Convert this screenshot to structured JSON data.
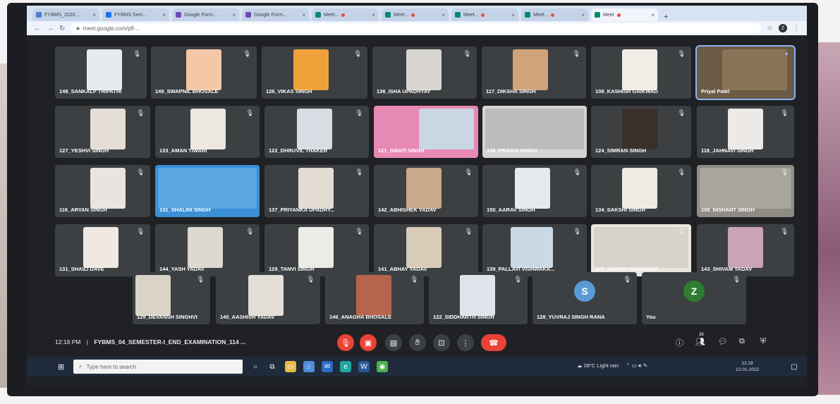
{
  "browser": {
    "tabs": [
      {
        "label": "FYBMS_2020..."
      },
      {
        "label": "FYBMS Sem..."
      },
      {
        "label": "Google Form..."
      },
      {
        "label": "Google Form..."
      },
      {
        "label": "Meet..."
      },
      {
        "label": "Meet..."
      },
      {
        "label": "Meet..."
      },
      {
        "label": "Meet..."
      },
      {
        "label": "Meet..."
      }
    ],
    "active_tab": {
      "label": "Meet"
    },
    "url": "meet.google.com/pfl-...",
    "profile_initial": "Z"
  },
  "participants": {
    "row1": [
      "148_SANKALP TRIPATHI",
      "149_SWAPNIL BHOSALE",
      "126_VIKAS SINGH",
      "136_ISHA UPADHYAY",
      "117_DIKSHA SINGH",
      "108_KASHISH GAIKWAD",
      "Priyal Patel"
    ],
    "row2": [
      "127_YESHVI SINGH",
      "133_AMAN TIWARI",
      "122_DHRUVIL THAKER",
      "121_SWATI SINGH",
      "130_PRACHI SINGH",
      "124_SIMRAN SINGH",
      "118_JAHNAVI SINGH"
    ],
    "row3": [
      "116_ARYAN SINGH",
      "131_SHALINI SINGH",
      "137_PRIYANKA UPADHY...",
      "142_ABHISHEK YADAV",
      "150_AARAV SINGH",
      "134_SAKSHI SINGH",
      "109_NISHANT SINGH"
    ],
    "row4": [
      "131_SHAILI DAVE",
      "144_YASH YADAV",
      "129_TANVI SINGH",
      "141_ABHAY YADAV",
      "139_PALLAVI VISHWAKA...",
      "147_SAKSHI VANASKAR",
      "143_SHIVAM YADAV"
    ],
    "row5": [
      "129_DEVANSH SINGHVI",
      "140_AASHISH YADAV",
      "146_ANAGHA BHOSALE",
      "122_SIDDHARTH SINGH",
      "128_YUVRAJ SINGH RANA",
      "You"
    ],
    "avatar_initials": {
      "yuvraj": "S",
      "you": "Z"
    }
  },
  "meeting": {
    "time": "12:18 PM",
    "separator": "|",
    "title": "FYBMS_04_SEMESTER-I_END_EXAMINATION_114 ...",
    "participant_count": "38"
  },
  "taskbar": {
    "search_placeholder": "Type here to search",
    "weather": "28°C Light rain",
    "clock_time": "12:18",
    "clock_date": "12-01-2022"
  },
  "colors": {
    "meet_bg": "#202124",
    "tile_bg": "#3c4043",
    "end_call": "#ea4335",
    "avatar_blue": "#5b9bd5",
    "avatar_green": "#2e7d32"
  }
}
